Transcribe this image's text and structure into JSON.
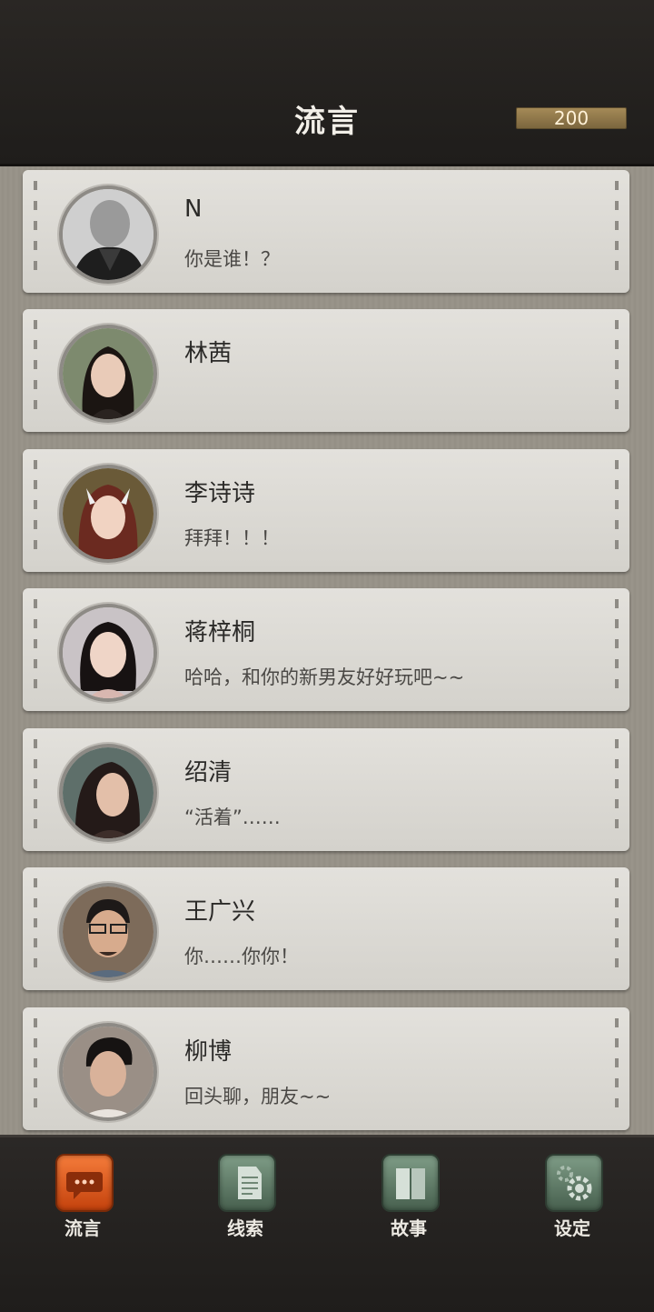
{
  "header": {
    "title": "流言",
    "currency": "200"
  },
  "contacts": [
    {
      "name": "N",
      "message": "你是谁！？"
    },
    {
      "name": "林茜",
      "message": ""
    },
    {
      "name": "李诗诗",
      "message": "拜拜！！！"
    },
    {
      "name": "蒋梓桐",
      "message": "哈哈，和你的新男友好好玩吧~~"
    },
    {
      "name": "绍清",
      "message": "“活着”……"
    },
    {
      "name": "王广兴",
      "message": "你……你你！"
    },
    {
      "name": "柳博",
      "message": "回头聊，朋友~~"
    }
  ],
  "tabs": [
    {
      "label": "流言",
      "icon": "chat-bubble-icon",
      "active": true
    },
    {
      "label": "线索",
      "icon": "document-icon",
      "active": false
    },
    {
      "label": "故事",
      "icon": "book-icon",
      "active": false
    },
    {
      "label": "设定",
      "icon": "gear-icon",
      "active": false
    }
  ],
  "colors": {
    "active_tab": "#e35a1c",
    "inactive_tab": "#5f7b66",
    "card": "#dedcd7",
    "header": "#252220"
  }
}
